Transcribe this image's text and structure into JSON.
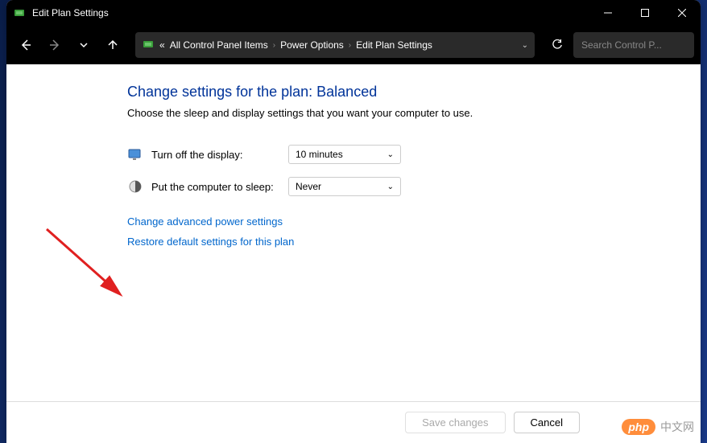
{
  "titlebar": {
    "title": "Edit Plan Settings"
  },
  "breadcrumb": {
    "prefix": "«",
    "items": [
      "All Control Panel Items",
      "Power Options",
      "Edit Plan Settings"
    ]
  },
  "search": {
    "placeholder": "Search Control P..."
  },
  "main": {
    "heading": "Change settings for the plan: Balanced",
    "subtext": "Choose the sleep and display settings that you want your computer to use.",
    "settings": {
      "display_label": "Turn off the display:",
      "display_value": "10 minutes",
      "sleep_label": "Put the computer to sleep:",
      "sleep_value": "Never"
    },
    "links": {
      "advanced": "Change advanced power settings",
      "restore": "Restore default settings for this plan"
    }
  },
  "footer": {
    "save": "Save changes",
    "cancel": "Cancel"
  },
  "watermark": {
    "badge": "php",
    "text": "中文网"
  }
}
